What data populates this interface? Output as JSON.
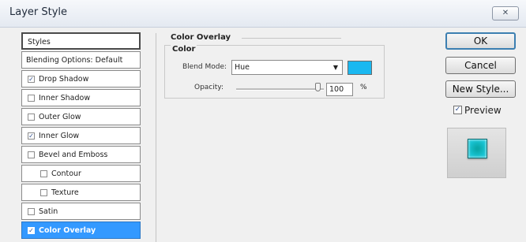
{
  "window": {
    "title": "Layer Style"
  },
  "styles_list": {
    "header": "Styles",
    "items": [
      {
        "label": "Blending Options: Default",
        "checkbox": false,
        "checked": false
      },
      {
        "label": "Drop Shadow",
        "checkbox": true,
        "checked": true
      },
      {
        "label": "Inner Shadow",
        "checkbox": true,
        "checked": false
      },
      {
        "label": "Outer Glow",
        "checkbox": true,
        "checked": false
      },
      {
        "label": "Inner Glow",
        "checkbox": true,
        "checked": true
      },
      {
        "label": "Bevel and Emboss",
        "checkbox": true,
        "checked": false
      },
      {
        "label": "Contour",
        "checkbox": true,
        "checked": false
      },
      {
        "label": "Texture",
        "checkbox": true,
        "checked": false
      },
      {
        "label": "Satin",
        "checkbox": true,
        "checked": false
      },
      {
        "label": "Color Overlay",
        "checkbox": true,
        "checked": true,
        "selected": true
      }
    ]
  },
  "panel": {
    "title": "Color Overlay",
    "group_title": "Color",
    "blend_mode_label": "Blend Mode:",
    "blend_mode_value": "Hue",
    "overlay_color": "#1ab8f0",
    "opacity_label": "Opacity:",
    "opacity_value": "100",
    "opacity_unit": "%",
    "opacity_level": 1.0
  },
  "buttons": {
    "ok": "OK",
    "cancel": "Cancel",
    "new_style": "New Style..."
  },
  "preview": {
    "label": "Preview",
    "checked": true
  },
  "icons": {
    "close": "close-icon",
    "dropdown": "chevron-down-icon",
    "check": "check-icon"
  }
}
